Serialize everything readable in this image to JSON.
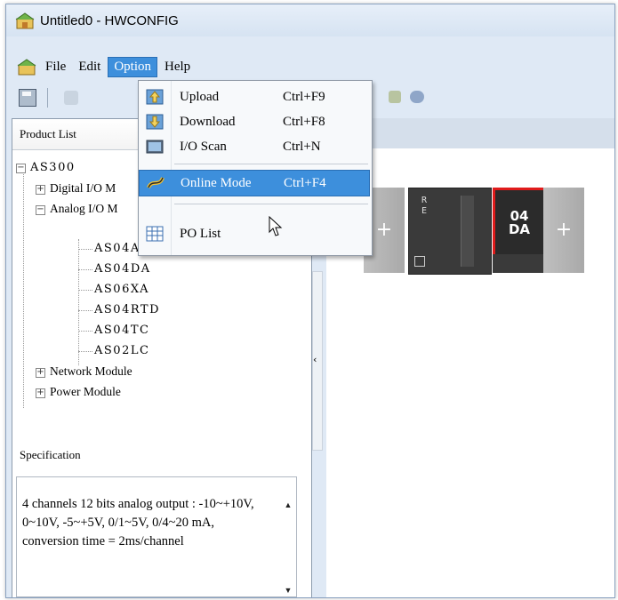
{
  "window": {
    "title": "Untitled0 - HWCONFIG"
  },
  "menubar": {
    "items": [
      {
        "label": "File",
        "active": false
      },
      {
        "label": "Edit",
        "active": false
      },
      {
        "label": "Option",
        "active": true
      },
      {
        "label": "Help",
        "active": false
      }
    ]
  },
  "option_menu": {
    "items": [
      {
        "label": "Upload",
        "shortcut": "Ctrl+F9",
        "icon": "upload-icon"
      },
      {
        "label": "Download",
        "shortcut": "Ctrl+F8",
        "icon": "download-icon"
      },
      {
        "label": "I/O Scan",
        "shortcut": "Ctrl+N",
        "icon": "io-scan-icon"
      },
      {
        "label": "Online Mode",
        "shortcut": "Ctrl+F4",
        "icon": "online-mode-icon",
        "highlighted": true
      },
      {
        "label": "PO List",
        "shortcut": "",
        "icon": "po-list-icon"
      }
    ]
  },
  "product_list": {
    "header": "Product List",
    "root": "AS300",
    "groups": [
      {
        "label": "Digital I/O M"
      },
      {
        "label": "Analog I/O M"
      },
      {
        "label": "Network Module"
      },
      {
        "label": "Power Module"
      }
    ],
    "analog_items": [
      "AS04AD",
      "AS04DA",
      "AS06XA",
      "AS04RTD",
      "AS04TC",
      "AS02LC"
    ]
  },
  "specification": {
    "label": "Specification",
    "text": "4 channels 12 bits analog output : -10~+10V, 0~10V, -5~+5V, 0/1~5V, 0/4~20 mA, conversion time = 2ms/channel"
  },
  "rack": {
    "cpu_leds": [
      "R",
      "E"
    ],
    "module_label_line1": "04",
    "module_label_line2": "DA",
    "add_glyph": "+",
    "selected_color": "#e01b1b"
  },
  "colors": {
    "menu_highlight": "#3d8fdc",
    "window_bg": "#dfe9f5"
  }
}
